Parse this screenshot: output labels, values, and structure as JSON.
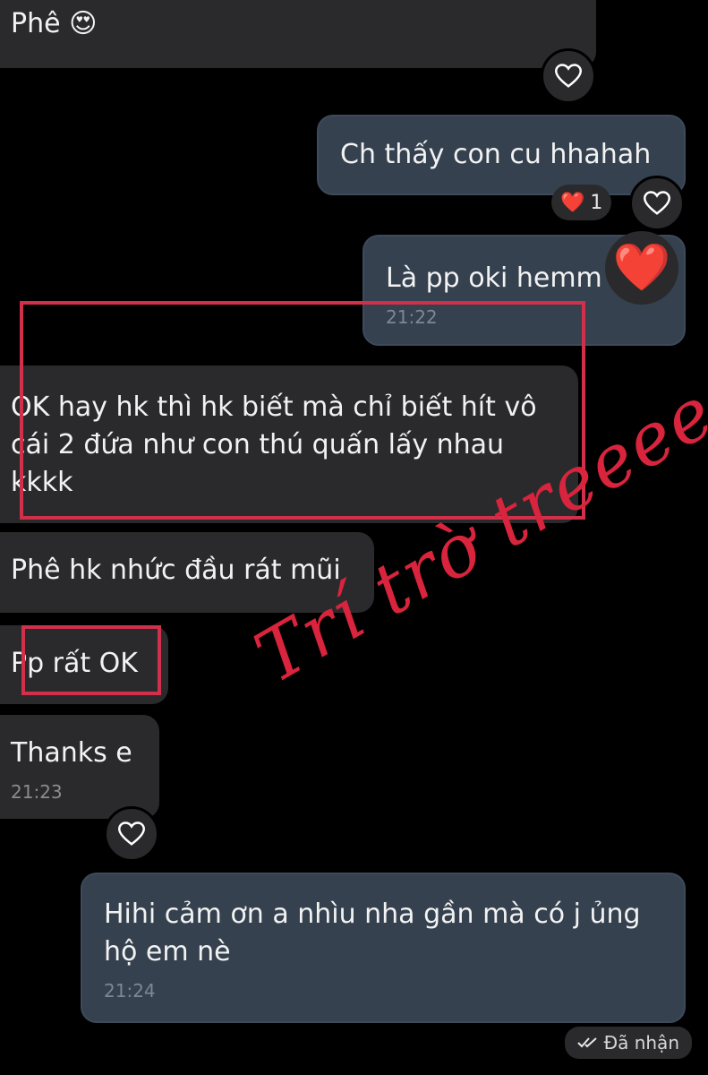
{
  "messages": [
    {
      "text": "Phê",
      "emoji": "😍"
    },
    {
      "text": "Ch thấy con cu hhahah"
    },
    {
      "text": "Là pp oki hemm",
      "time": "21:22"
    },
    {
      "text": "OK hay hk thì hk biết mà chỉ biết hít vô cái 2 đứa như con thú quấn lấy nhau kkkk"
    },
    {
      "text": "Phê hk nhức đầu rát mũi"
    },
    {
      "text": "Pp rất OK"
    },
    {
      "text": "Thanks e",
      "time": "21:23"
    },
    {
      "text": "Hihi cảm ơn a nhìu nha  gần mà có j ủng hộ em nè",
      "time": "21:24"
    }
  ],
  "reaction": {
    "emoji": "❤️",
    "count": "1"
  },
  "big_reaction": "❤️",
  "watermark": "Trí trờ treeee",
  "status": {
    "label": "Đã nhận",
    "icon": "double-check-icon"
  },
  "colors": {
    "incoming": "#2a2a2c",
    "outgoing": "#35414f",
    "highlight": "#d0304a",
    "watermark": "#d8243c"
  }
}
